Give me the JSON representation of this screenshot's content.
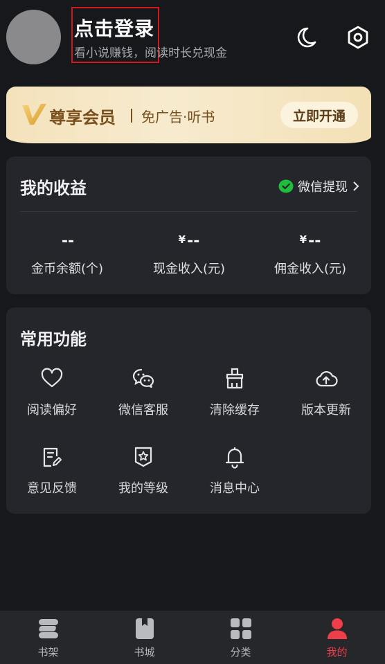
{
  "header": {
    "login_title": "点击登录",
    "login_subtitle": "看小说赚钱，阅读时长兑现金",
    "moon_icon": "moon-icon",
    "settings_icon": "hexagon-settings-icon"
  },
  "vip": {
    "name": "尊享会员",
    "desc": "免广告·听书",
    "button": "立即开通",
    "colors": {
      "text": "#7a4f1e",
      "bg": "#f4e2bb"
    }
  },
  "earnings": {
    "title": "我的收益",
    "withdraw": "微信提现",
    "stats": [
      {
        "currency": "",
        "value": "--",
        "label": "金币余额(个)"
      },
      {
        "currency": "¥",
        "value": "--",
        "label": "现金收入(元)"
      },
      {
        "currency": "¥",
        "value": "--",
        "label": "佣金收入(元)"
      }
    ]
  },
  "functions": {
    "title": "常用功能",
    "items": [
      {
        "label": "阅读偏好",
        "icon": "heart-icon"
      },
      {
        "label": "微信客服",
        "icon": "wechat-icon"
      },
      {
        "label": "清除缓存",
        "icon": "broom-icon"
      },
      {
        "label": "版本更新",
        "icon": "cloud-upload-icon"
      },
      {
        "label": "意见反馈",
        "icon": "feedback-edit-icon"
      },
      {
        "label": "我的等级",
        "icon": "star-badge-icon"
      },
      {
        "label": "消息中心",
        "icon": "bell-icon"
      }
    ]
  },
  "nav": {
    "items": [
      {
        "label": "书架",
        "icon": "bookshelf-icon"
      },
      {
        "label": "书城",
        "icon": "bookstore-icon"
      },
      {
        "label": "分类",
        "icon": "grid-category-icon"
      },
      {
        "label": "我的",
        "icon": "user-icon",
        "active": true
      }
    ],
    "active_color": "#ef3e4a"
  }
}
